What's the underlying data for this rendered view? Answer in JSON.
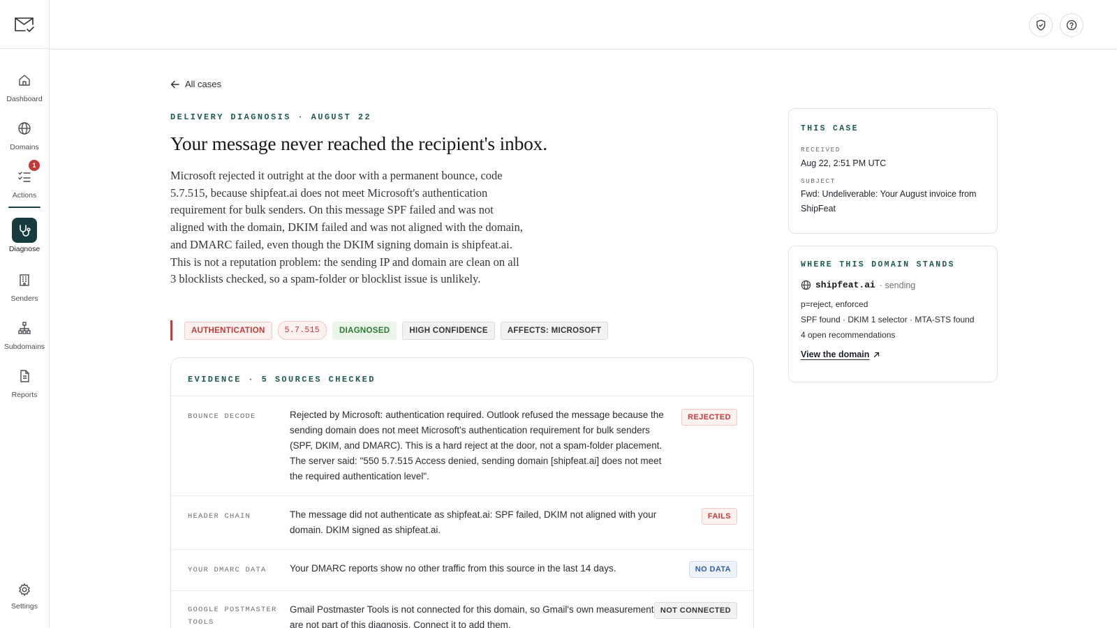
{
  "sidebar": {
    "items": [
      {
        "label": "Dashboard",
        "icon": "home-icon"
      },
      {
        "label": "Domains",
        "icon": "globe-icon"
      },
      {
        "label": "Actions",
        "icon": "checklist-icon",
        "badge": "1"
      },
      {
        "label": "Diagnose",
        "icon": "stethoscope-icon",
        "active": true
      },
      {
        "label": "Senders",
        "icon": "building-icon"
      },
      {
        "label": "Subdomains",
        "icon": "hierarchy-icon"
      },
      {
        "label": "Reports",
        "icon": "document-icon"
      }
    ],
    "settings_label": "Settings"
  },
  "topbar": {
    "icons": [
      "shield-check-icon",
      "help-icon"
    ]
  },
  "main": {
    "back_label": "All cases",
    "eyebrow": "DELIVERY DIAGNOSIS · AUGUST 22",
    "title": "Your message never reached the recipient's inbox.",
    "summary": "Microsoft rejected it outright at the door with a permanent bounce, code 5.7.515, because shipfeat.ai does not meet Microsoft's authentication requirement for bulk senders. On this message SPF failed and was not aligned with the domain, DKIM failed and was not aligned with the domain, and DMARC failed, even though the DKIM signing domain is shipfeat.ai. This is not a reputation problem: the sending IP and domain are clean on all 3 blocklists checked, so a spam-folder or blocklist issue is unlikely.",
    "tags": [
      "AUTHENTICATION",
      "5.7.515",
      "DIAGNOSED",
      "HIGH CONFIDENCE",
      "AFFECTS: MICROSOFT"
    ]
  },
  "evidence": {
    "header": "EVIDENCE · 5 SOURCES CHECKED",
    "rows": [
      {
        "source": "BOUNCE DECODE",
        "text": "Rejected by Microsoft: authentication required. Outlook refused the message because the sending domain does not meet Microsoft's authentication requirement for bulk senders (SPF, DKIM, and DMARC). This is a hard reject at the door, not a spam-folder placement. The server said: \"550 5.7.515 Access denied, sending domain [shipfeat.ai] does not meet the required authentication level\".",
        "status": "REJECTED"
      },
      {
        "source": "HEADER CHAIN",
        "text": "The message did not authenticate as shipfeat.ai: SPF failed, DKIM not aligned with your domain. DKIM signed as shipfeat.ai.",
        "status": "FAILS"
      },
      {
        "source": "YOUR DMARC DATA",
        "text": "Your DMARC reports show no other traffic from this source in the last 14 days.",
        "status": "NO DATA"
      },
      {
        "source": "GOOGLE POSTMASTER TOOLS",
        "text": "Gmail Postmaster Tools is not connected for this domain, so Gmail's own measurements are not part of this diagnosis. Connect it to add them.",
        "status": "NOT CONNECTED"
      }
    ]
  },
  "case_card": {
    "title": "THIS CASE",
    "received_label": "RECEIVED",
    "received_value": "Aug 22, 2:51 PM UTC",
    "subject_label": "SUBJECT",
    "subject_value": "Fwd: Undeliverable: Your August invoice from ShipFeat"
  },
  "domain_card": {
    "title": "WHERE THIS DOMAIN STANDS",
    "domain": "shipfeat.ai",
    "state": "· sending",
    "facts": [
      "p=reject, enforced",
      "SPF found · DKIM 1 selector · MTA-STS found",
      "4 open recommendations"
    ],
    "link_label": "View the domain"
  },
  "colors": {
    "accent": "#163c3f",
    "eyebrow": "#1d5b52",
    "danger": "#c23a3a",
    "success": "#2e7a35",
    "info": "#2f5fa7"
  }
}
